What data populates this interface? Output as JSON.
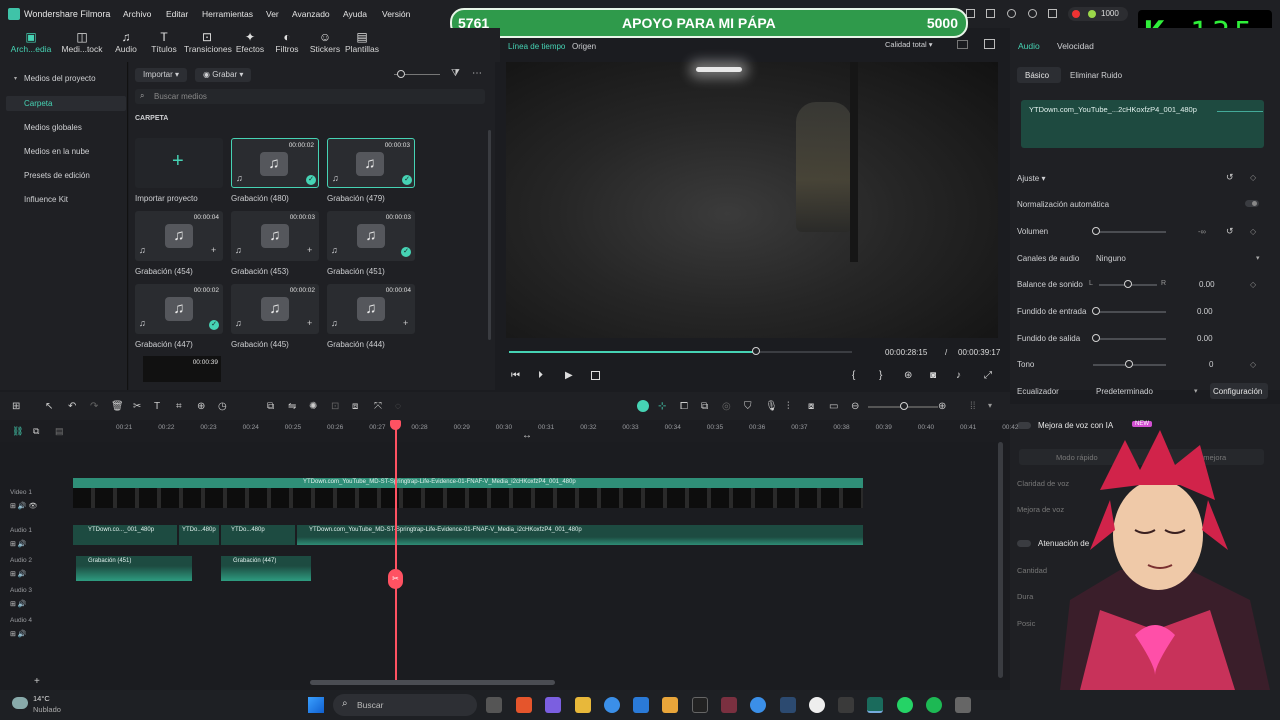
{
  "app": {
    "title": "Wondershare Filmora",
    "menus": [
      "Archivo",
      "Editar",
      "Herramientas",
      "Ver",
      "Avanzado",
      "Ayuda",
      "Versión"
    ]
  },
  "toolbar": {
    "items": [
      {
        "label": "Arch...edia",
        "icon": "folder-media-icon"
      },
      {
        "label": "Medi...tock",
        "icon": "stock-icon"
      },
      {
        "label": "Audio",
        "icon": "music-note-icon"
      },
      {
        "label": "Títulos",
        "icon": "text-icon"
      },
      {
        "label": "Transiciones",
        "icon": "transition-icon"
      },
      {
        "label": "Efectos",
        "icon": "effects-icon"
      },
      {
        "label": "Filtros",
        "icon": "filter-icon"
      },
      {
        "label": "Stickers",
        "icon": "sticker-icon"
      },
      {
        "label": "Plantillas",
        "icon": "template-icon"
      }
    ]
  },
  "leftnav": {
    "items": [
      "Medios del proyecto",
      "Carpeta",
      "Medios globales",
      "Medios en la nube",
      "Presets de edición",
      "Influence Kit"
    ]
  },
  "media": {
    "import_label": "Importar",
    "record_label": "Grabar",
    "search_placeholder": "Buscar medios",
    "section": "CARPETA",
    "import_project": "Importar proyecto",
    "items": [
      {
        "name": "Grabación (480)",
        "duration": "00:00:02"
      },
      {
        "name": "Grabación (479)",
        "duration": "00:00:03"
      },
      {
        "name": "Grabación (454)",
        "duration": "00:00:04"
      },
      {
        "name": "Grabación (453)",
        "duration": "00:00:03"
      },
      {
        "name": "Grabación (451)",
        "duration": "00:00:03"
      },
      {
        "name": "Grabación (447)",
        "duration": "00:00:02"
      },
      {
        "name": "Grabación (445)",
        "duration": "00:00:02"
      },
      {
        "name": "Grabación (444)",
        "duration": "00:00:04"
      },
      {
        "name": "",
        "duration": "00:00:39"
      }
    ]
  },
  "player": {
    "tab_timeline": "Línea de tiempo",
    "tab_origin": "Origen",
    "quality": "Calidad total",
    "current": "00:00:28:15",
    "sep": "/",
    "total": "00:00:39:17",
    "progress": 0.72
  },
  "banner": {
    "left": "5761",
    "title": "APOYO PARA MI PÁPA",
    "right": "5000"
  },
  "counter": {
    "letter": "K",
    "value": "135"
  },
  "right": {
    "tab_audio": "Audio",
    "tab_speed": "Velocidad",
    "sub_basic": "Básico",
    "sub_noise": "Eliminar Ruido",
    "clip": "YTDown.com_YouTube_...2cHKoxfzP4_001_480p",
    "adjust": "Ajuste",
    "auto_norm": "Normalización automática",
    "volume": "Volumen",
    "volume_val": "-∞",
    "channels": "Canales de audio",
    "channels_val": "Ninguno",
    "balance": "Balance de sonido",
    "balance_l": "L",
    "balance_r": "R",
    "balance_val": "0.00",
    "fadein": "Fundido de entrada",
    "fadein_val": "0.00",
    "fadeout": "Fundido de salida",
    "fadeout_val": "0.00",
    "pitch": "Tono",
    "pitch_val": "0",
    "eq": "Ecualizador",
    "eq_val": "Predeterminado",
    "config": "Configuración",
    "ai_voice": "Mejora de voz con IA",
    "new": "NEW",
    "fast_mode": "Modo rápido",
    "improve": "e mejora",
    "voice_clarity": "Claridad de voz",
    "voice_improve": "Mejora de voz",
    "atten": "Atenuación de",
    "quantity": "Cantidad",
    "dur": "Dura",
    "pos": "Posic"
  },
  "timeline": {
    "ticks": [
      "00:21",
      "00:22",
      "00:23",
      "00:24",
      "00:25",
      "00:26",
      "00:27",
      "00:28",
      "00:29",
      "00:30",
      "00:31",
      "00:32",
      "00:33",
      "00:34",
      "00:35",
      "00:36",
      "00:37",
      "00:38",
      "00:39",
      "00:40",
      "00:41",
      "00:42"
    ],
    "tracks": [
      "Video 1",
      "Audio 1",
      "Audio 2",
      "Audio 3",
      "Audio 4"
    ],
    "video_clip": "YTDown.com_YouTube_MD-ST-Springtrap-Life-Evidence-01-FNAF-V_Media_i2cHKoxfzP4_001_480p",
    "audio_clips": [
      "YTDown.co..._001_480p",
      "YTDo...480p",
      "YTDo...480p",
      "YTDown.com_YouTube_MD-ST-Springtrap-Life-Evidence-01-FNAF-V_Media_i2cHKoxfzP4_001_480p"
    ],
    "audio2_clips": [
      "Grabación (451)",
      "Grabación (447)"
    ]
  },
  "taskbar": {
    "temp": "14°C",
    "weather": "Nublado",
    "search": "Buscar"
  },
  "colors": {
    "accent": "#46d3b4",
    "playhead": "#ff5262",
    "banner": "#2f9a4b"
  }
}
